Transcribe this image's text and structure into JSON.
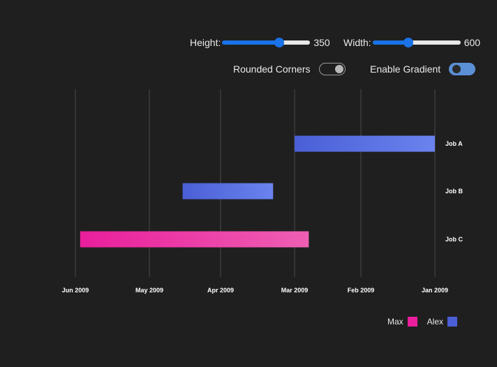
{
  "controls": {
    "height": {
      "label": "Height:",
      "value": "350",
      "fraction": 0.65
    },
    "width": {
      "label": "Width:",
      "value": "600",
      "fraction": 0.41
    },
    "rounded_corners": {
      "label": "Rounded Corners",
      "enabled": false
    },
    "enable_gradient": {
      "label": "Enable Gradient",
      "enabled": true
    }
  },
  "legend": [
    {
      "name": "Max",
      "color": "#e91e9c"
    },
    {
      "name": "Alex",
      "color": "#4a5fd6"
    }
  ],
  "chart_data": {
    "type": "gantt",
    "x_axis": {
      "ticks": [
        "Jun 2009",
        "May 2009",
        "Apr 2009",
        "Mar 2009",
        "Feb 2009",
        "Jan 2009"
      ],
      "reversed": true,
      "range": [
        "2009-01-01",
        "2009-06-01"
      ]
    },
    "categories": [
      "Job A",
      "Job B",
      "Job C"
    ],
    "tasks": [
      {
        "name": "Job A",
        "owner": "Alex",
        "start": "2009-01-01",
        "end": "2009-03-01"
      },
      {
        "name": "Job B",
        "owner": "Alex",
        "start": "2009-03-10",
        "end": "2009-04-17"
      },
      {
        "name": "Job C",
        "owner": "Max",
        "start": "2009-02-23",
        "end": "2009-05-30"
      }
    ],
    "colors": {
      "Alex": [
        "#4a5fd6",
        "#6a83ee"
      ],
      "Max": [
        "#e91e9c",
        "#ef5fb3"
      ]
    },
    "grid": true,
    "legend_position": "bottom-right"
  }
}
